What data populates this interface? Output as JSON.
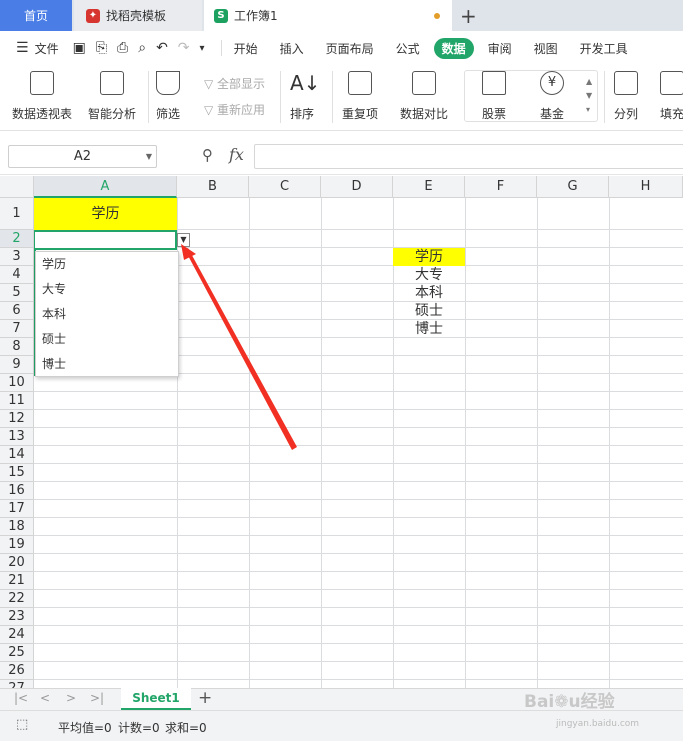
{
  "tabs": {
    "home": "首页",
    "template": "找稻壳模板",
    "workbook": "工作簿1"
  },
  "menu": {
    "file": "文件",
    "items": [
      "开始",
      "插入",
      "页面布局",
      "公式",
      "数据",
      "审阅",
      "视图",
      "开发工具"
    ],
    "active": "数据"
  },
  "ribbon": {
    "pivot": "数据透视表",
    "smart_analysis": "智能分析",
    "filter": "筛选",
    "show_all": "全部显示",
    "reapply": "重新应用",
    "sort": "排序",
    "duplicates": "重复项",
    "compare": "数据对比",
    "stock": "股票",
    "fund": "基金",
    "split": "分列",
    "fill": "填充"
  },
  "formula_bar": {
    "name_box": "A2",
    "fx": "fx",
    "value": ""
  },
  "columns": [
    "A",
    "B",
    "C",
    "D",
    "E",
    "F",
    "G",
    "H"
  ],
  "rows": [
    "1",
    "2",
    "3",
    "4",
    "5",
    "6",
    "7",
    "8",
    "9",
    "10",
    "11",
    "12",
    "13",
    "14",
    "15",
    "16",
    "17",
    "18",
    "19",
    "20",
    "21",
    "22",
    "23",
    "24",
    "25",
    "26",
    "27"
  ],
  "cells": {
    "A1": "学历",
    "E3": "学历",
    "E4": "大专",
    "E5": "本科",
    "E6": "硕士",
    "E7": "博士"
  },
  "dropdown_options": [
    "学历",
    "大专",
    "本科",
    "硕士",
    "博士"
  ],
  "sheet_tab": "Sheet1",
  "status": {
    "average": "平均值=0",
    "count": "计数=0",
    "sum": "求和=0"
  },
  "highlight_color": "#ffff00",
  "accent_color": "#22a568",
  "watermark": "Baidu经验 jingyan.baidu.com"
}
